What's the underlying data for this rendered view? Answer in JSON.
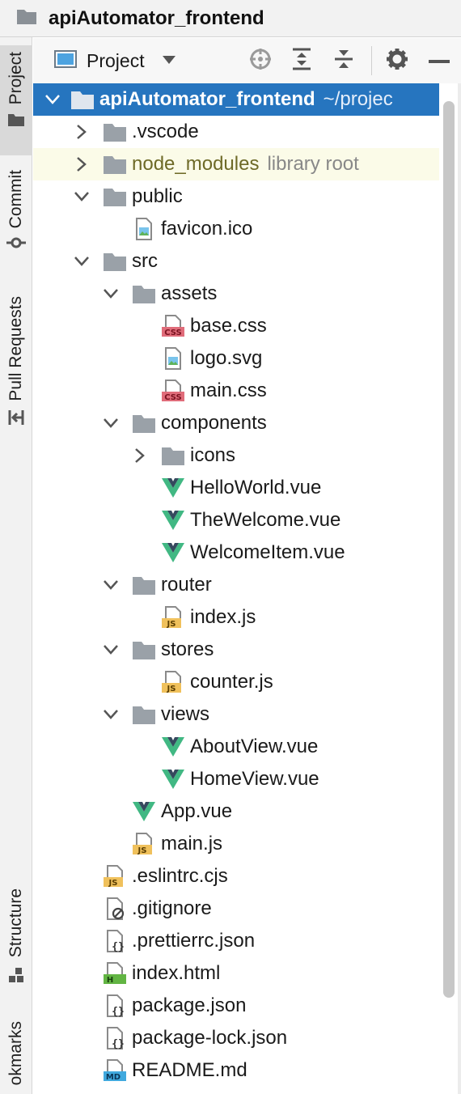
{
  "window": {
    "title": "apiAutomator_frontend"
  },
  "sidebar": {
    "items": [
      {
        "label": "Project",
        "icon": "folder-icon",
        "active": true
      },
      {
        "label": "Commit",
        "icon": "commit-icon",
        "active": false
      },
      {
        "label": "Pull Requests",
        "icon": "pull-request-icon",
        "active": false
      },
      {
        "label": "Structure",
        "icon": "structure-icon",
        "active": false
      },
      {
        "label": "okmarks",
        "icon": "bookmark-icon",
        "active": false
      }
    ]
  },
  "toolbar": {
    "view_label": "Project",
    "buttons": [
      "locate-icon",
      "expand-all-icon",
      "collapse-all-icon",
      "gear-icon",
      "minimize-icon"
    ]
  },
  "tree": {
    "root": {
      "label": "apiAutomator_frontend",
      "hint": "~/projec"
    },
    "items": [
      {
        "label": ".vscode",
        "level": 1,
        "type": "folder",
        "arrow": "right"
      },
      {
        "label": "node_modules",
        "level": 1,
        "type": "folder",
        "arrow": "right",
        "hint": "library root"
      },
      {
        "label": "public",
        "level": 1,
        "type": "folder",
        "arrow": "down"
      },
      {
        "label": "favicon.ico",
        "level": 2,
        "type": "image"
      },
      {
        "label": "src",
        "level": 1,
        "type": "folder",
        "arrow": "down"
      },
      {
        "label": "assets",
        "level": 2,
        "type": "folder",
        "arrow": "down"
      },
      {
        "label": "base.css",
        "level": 3,
        "type": "css"
      },
      {
        "label": "logo.svg",
        "level": 3,
        "type": "image"
      },
      {
        "label": "main.css",
        "level": 3,
        "type": "css"
      },
      {
        "label": "components",
        "level": 2,
        "type": "folder",
        "arrow": "down"
      },
      {
        "label": "icons",
        "level": 3,
        "type": "folder",
        "arrow": "right"
      },
      {
        "label": "HelloWorld.vue",
        "level": 3,
        "type": "vue"
      },
      {
        "label": "TheWelcome.vue",
        "level": 3,
        "type": "vue"
      },
      {
        "label": "WelcomeItem.vue",
        "level": 3,
        "type": "vue"
      },
      {
        "label": "router",
        "level": 2,
        "type": "folder",
        "arrow": "down"
      },
      {
        "label": "index.js",
        "level": 3,
        "type": "js"
      },
      {
        "label": "stores",
        "level": 2,
        "type": "folder",
        "arrow": "down"
      },
      {
        "label": "counter.js",
        "level": 3,
        "type": "js"
      },
      {
        "label": "views",
        "level": 2,
        "type": "folder",
        "arrow": "down"
      },
      {
        "label": "AboutView.vue",
        "level": 3,
        "type": "vue"
      },
      {
        "label": "HomeView.vue",
        "level": 3,
        "type": "vue"
      },
      {
        "label": "App.vue",
        "level": 2,
        "type": "vue"
      },
      {
        "label": "main.js",
        "level": 2,
        "type": "js"
      },
      {
        "label": ".eslintrc.cjs",
        "level": 1,
        "type": "js"
      },
      {
        "label": ".gitignore",
        "level": 1,
        "type": "ignore"
      },
      {
        "label": ".prettierrc.json",
        "level": 1,
        "type": "json"
      },
      {
        "label": "index.html",
        "level": 1,
        "type": "html"
      },
      {
        "label": "package.json",
        "level": 1,
        "type": "json"
      },
      {
        "label": "package-lock.json",
        "level": 1,
        "type": "json"
      },
      {
        "label": "README.md",
        "level": 1,
        "type": "md"
      }
    ]
  },
  "colors": {
    "selection": "#2675bf",
    "library_bg": "#fbfbe8",
    "folder": "#9aa1a8",
    "vue_green": "#41b883",
    "vue_dark": "#35495e",
    "js_badge": "#f0c15c",
    "css_badge": "#e06c7a",
    "html_badge": "#62b543",
    "md_badge": "#40a9de"
  }
}
